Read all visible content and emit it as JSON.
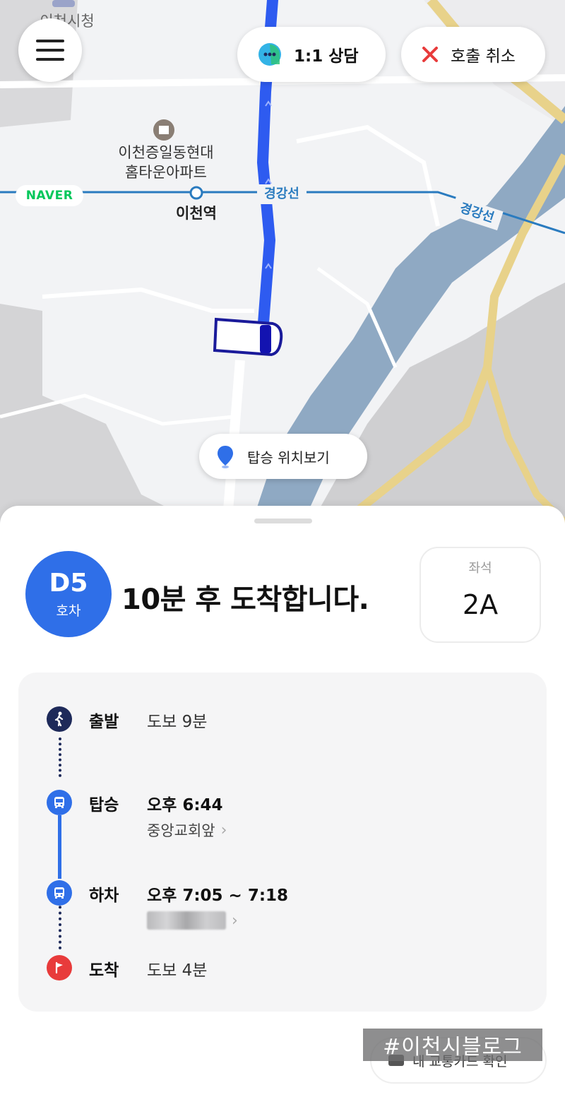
{
  "map": {
    "top_label": "이천시청",
    "poi_line1": "이천증일동현대",
    "poi_line2": "홈타운아파트",
    "station": "이천역",
    "rail_line_1": "경강선",
    "rail_line_2": "경강선",
    "brand": "NAVER",
    "icons": {
      "menu": "hamburger-icon",
      "chat": "chat-bubble-icon",
      "cancel": "x-icon",
      "pin": "location-pin-icon",
      "vehicle": "van-icon"
    }
  },
  "header": {
    "chat_label": "1:1 상담",
    "cancel_label": "호출 취소"
  },
  "locate_button": {
    "label": "탑승 위치보기"
  },
  "trip": {
    "vehicle_code": "D5",
    "vehicle_unit": "호차",
    "arrival_message": "10분 후 도착합니다.",
    "seat_label": "좌석",
    "seat_value": "2A"
  },
  "route": [
    {
      "label": "출발",
      "main": "도보 9분",
      "sub": "",
      "icon": "walk-icon"
    },
    {
      "label": "탑승",
      "main": "오후 6:44",
      "sub": "중앙교회앞",
      "icon": "bus-icon"
    },
    {
      "label": "하차",
      "main": "오후 7:05 ~ 7:18",
      "sub": "",
      "icon": "bus-icon"
    },
    {
      "label": "도착",
      "main": "도보 4분",
      "sub": "",
      "icon": "flag-icon"
    }
  ],
  "footer": {
    "card_button_label": "내 교통카드 확인",
    "watermark": "#이천시블로그"
  },
  "colors": {
    "accent_blue": "#2f6fe8",
    "navy": "#1e2a5a",
    "red": "#e83b3b",
    "naver_green": "#03c75a",
    "rail_blue": "#2a7bbf"
  }
}
